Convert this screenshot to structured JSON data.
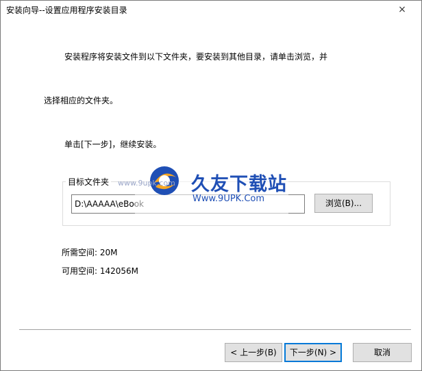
{
  "window": {
    "title": "安装向导--设置应用程序安装目录",
    "close_glyph": "×"
  },
  "instructions": {
    "line1": "安装程序将安装文件到以下文件夹，要安装到其他目录，请单击浏览，并",
    "line2": "选择相应的文件夹。",
    "line3": "单击[下一步]，继续安装。"
  },
  "target_folder": {
    "label": "目标文件夹",
    "path_value": "D:\\AAAAA\\eBook",
    "browse_label": "浏览(B)..."
  },
  "space": {
    "required": "所需空间: 20M",
    "available": "可用空间: 142056M"
  },
  "buttons": {
    "back": "< 上一步(B)",
    "next": "下一步(N) >",
    "cancel": "取消"
  },
  "watermark": {
    "name": "久友下载站",
    "url": "Www.9UPK.Com",
    "faint_url": "www.9upk.com",
    "brand_blue": "#1f4fb5",
    "brand_orange": "#f5a623"
  },
  "colors": {
    "focus": "#0078d7",
    "button_bg": "#e1e1e1"
  }
}
